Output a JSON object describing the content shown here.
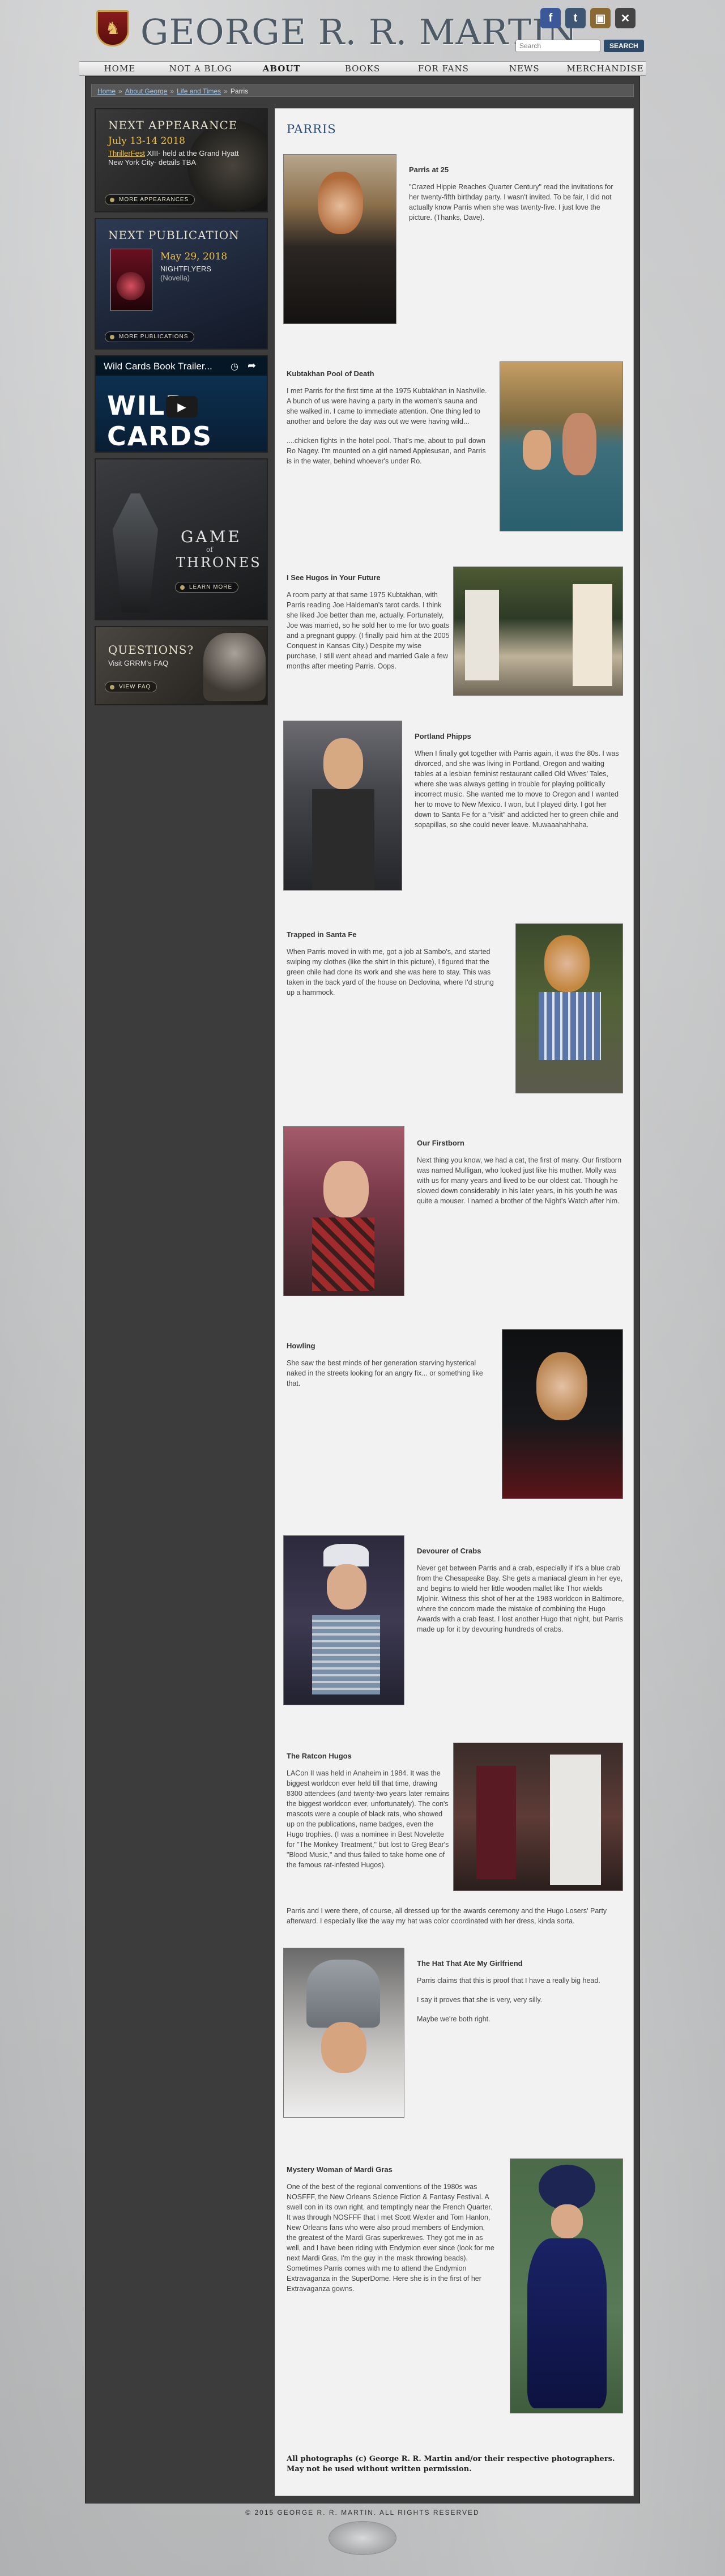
{
  "site": {
    "title": "GEORGE R. R. MARTIN",
    "crest_glyph": "♞",
    "social": [
      {
        "name": "facebook",
        "glyph": "f",
        "color": "#3b5998"
      },
      {
        "name": "tumblr",
        "glyph": "t",
        "color": "#3c5673"
      },
      {
        "name": "blog",
        "glyph": "▣",
        "color": "#8a6a32"
      },
      {
        "name": "x",
        "glyph": "✕",
        "color": "#444444"
      }
    ],
    "search_placeholder": "Search",
    "search_label": "SEARCH"
  },
  "nav": [
    "HOME",
    "NOT A BLOG",
    "ABOUT GEORGE",
    "BOOKS",
    "FOR FANS",
    "NEWS",
    "MERCHANDISE"
  ],
  "nav_active_index": 2,
  "breadcrumb": {
    "items": [
      "Home",
      "About George",
      "Life and Times"
    ],
    "current": "Parris"
  },
  "sidebar": {
    "appearance": {
      "heading": "NEXT APPEARANCE",
      "date": "July 13-14 2018",
      "link": "ThrillerFest",
      "text1": " XIII- held at the Grand Hyatt",
      "text2": "New York City- details TBA",
      "button": "MORE APPEARANCES"
    },
    "publication": {
      "heading": "NEXT PUBLICATION",
      "date": "May 29, 2018",
      "book": "NIGHTFLYERS",
      "type": "(Novella)",
      "button": "MORE PUBLICATIONS"
    },
    "wildcards": {
      "video_title": "Wild Cards Book Trailer...",
      "brand": "WILD CARDS"
    },
    "got": {
      "line1": "GAME",
      "of": "of",
      "line2": "THRONES",
      "button": "LEARN MORE"
    },
    "questions": {
      "heading": "QUESTIONS?",
      "text": "Visit GRRM's FAQ",
      "button": "VIEW FAQ"
    }
  },
  "page_title": "PARRIS",
  "stories": [
    {
      "title": "Parris at 25",
      "paragraphs": [
        "\"Crazed Hippie Reaches Quarter Century\" read the invitations for her twenty-fifth birthday party. I wasn't invited. To be fair, I did not actually know Parris when she was twenty-five. I just love the picture. (Thanks, Dave)."
      ]
    },
    {
      "title": "Kubtakhan Pool of Death",
      "paragraphs": [
        "I met Parris for the first time at the 1975 Kubtakhan in Nashville. A bunch of us were having a party in the women's sauna and she walked in. I came to immediate attention. One thing led to another and before the day was out we were having wild...",
        "....chicken fights in the hotel pool. That's me, about to pull down Ro Nagey. I'm mounted on a girl named Applesusan, and Parris is in the water, behind whoever's under Ro."
      ]
    },
    {
      "title": "I See Hugos in Your Future",
      "paragraphs": [
        "A room party at that same 1975 Kubtakhan, with Parris reading Joe Haldeman's tarot cards. I think she liked Joe better than me, actually. Fortunately, Joe was married, so he sold her to me for two goats and a pregnant guppy. (I finally paid him at the 2005 Conquest in Kansas City.) Despite my wise purchase, I still went ahead and married Gale a few months after meeting Parris. Oops."
      ]
    },
    {
      "title": "Portland Phipps",
      "paragraphs": [
        "When I finally got together with Parris again, it was the 80s. I was divorced, and she was living in Portland, Oregon and waiting tables at a lesbian feminist restaurant called Old Wives' Tales, where she was always getting in trouble for playing politically incorrect music. She wanted me to move to Oregon and I wanted her to move to New Mexico. I won, but I played dirty. I got her down to Santa Fe for a \"visit\" and addicted her to green chile and sopapillas, so she could never leave. Muwaaahahhaha."
      ]
    },
    {
      "title": "Trapped in Santa Fe",
      "paragraphs": [
        "When Parris moved in with me, got a job at Sambo's, and started swiping my clothes (like the shirt in this picture), I figured that the green chile had done its work and she was here to stay. This was taken in the back yard of the house on Declovina, where I'd strung up a hammock."
      ]
    },
    {
      "title": "Our Firstborn",
      "paragraphs": [
        "Next thing you know, we had a cat, the first of many. Our firstborn was named Mulligan, who looked just like his mother. Molly was with us for many years and lived to be our oldest cat. Though he slowed down considerably in his later years, in his youth he was quite a mouser. I named a brother of the Night's Watch after him."
      ]
    },
    {
      "title": "Howling",
      "paragraphs": [
        "She saw the best minds of her generation starving hysterical naked in the streets looking for an angry fix... or something like that."
      ]
    },
    {
      "title": "Devourer of Crabs",
      "paragraphs": [
        "Never get between Parris and a crab, especially if it's a blue crab from the Chesapeake Bay. She gets a maniacal gleam in her eye, and begins to wield her little wooden mallet like Thor wields Mjolnir. Witness this shot of her at the 1983 worldcon in Baltimore, where the concom made the mistake of combining the Hugo Awards with a crab feast. I lost another Hugo that night, but Parris made up for it by devouring hundreds of crabs."
      ]
    },
    {
      "title": "The Ratcon Hugos",
      "paragraphs": [
        "LACon II was held in Anaheim in 1984. It was the biggest worldcon ever held till that time, drawing 8300 attendees (and twenty-two years later remains the biggest worldcon ever, unfortunately). The con's mascots were a couple of black rats, who showed up on the publications, name badges, even the Hugo trophies. (I was a nominee in Best Novelette for \"The Monkey Treatment,\" but lost to Greg Bear's \"Blood Music,\" and thus failed to take home one of the famous rat-infested Hugos).",
        "Parris and I were there, of course, all dressed up for the awards ceremony and the Hugo Losers' Party afterward. I especially like the way my hat was color coordinated with her dress, kinda sorta."
      ]
    },
    {
      "title": "The Hat That Ate My Girlfriend",
      "paragraphs": [
        "Parris claims that this is proof that I have a really big head.",
        "I say it proves that she is very, very silly.",
        "Maybe we're both right."
      ]
    },
    {
      "title": "Mystery Woman of Mardi Gras",
      "paragraphs": [
        "One of the best of the regional conventions of the 1980s was NOSFFF, the New Orleans Science Fiction & Fantasy Festival. A swell con in its own right, and temptingly near the French Quarter. It was through NOSFFF that I met Scott Wexler and Tom Hanlon, New Orleans fans who were also proud members of Endymion, the greatest of the Mardi Gras superkrewes. They got me in as well, and I have been riding with Endymion ever since (look for me next Mardi Gras, I'm the guy in the mask throwing beads). Sometimes Parris comes with me to attend the Endymion Extravaganza in the SuperDome. Here she is in the first of her Extravaganza gowns."
      ]
    }
  ],
  "footer_note": "All photographs (c) George R. R. Martin and/or their respective photographers. May not be used without written permission.",
  "copyright": "© 2015 GEORGE R. R. MARTIN. ALL RIGHTS RESERVED"
}
